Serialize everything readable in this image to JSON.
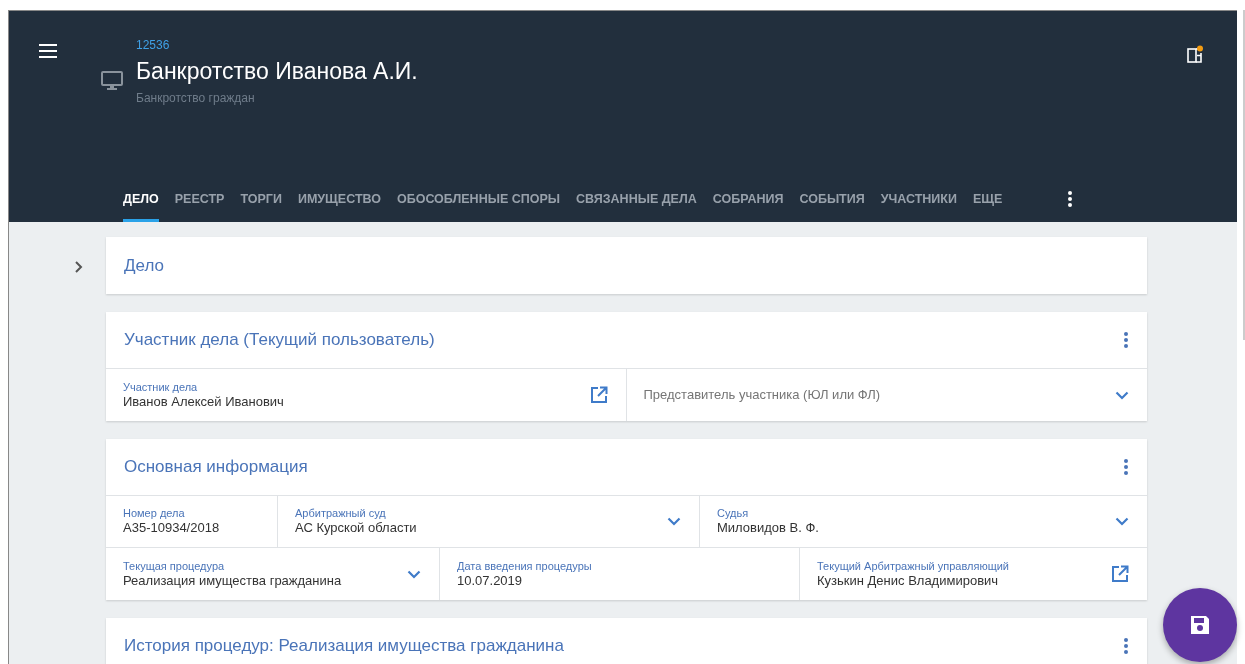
{
  "header": {
    "case_id": "12536",
    "title": "Банкротство Иванова А.И.",
    "subtitle": "Банкротство граждан"
  },
  "tabs": [
    {
      "label": "ДЕЛО",
      "selected": true
    },
    {
      "label": "РЕЕСТР",
      "selected": false
    },
    {
      "label": "ТОРГИ",
      "selected": false
    },
    {
      "label": "ИМУЩЕСТВО",
      "selected": false
    },
    {
      "label": "ОБОСОБЛЕННЫЕ СПОРЫ",
      "selected": false
    },
    {
      "label": "СВЯЗАННЫЕ ДЕЛА",
      "selected": false
    },
    {
      "label": "СОБРАНИЯ",
      "selected": false
    },
    {
      "label": "СОБЫТИЯ",
      "selected": false
    },
    {
      "label": "УЧАСТНИКИ",
      "selected": false
    },
    {
      "label": "ЕЩЕ",
      "selected": false
    }
  ],
  "sections": [
    {
      "title": "Дело",
      "collapsed": true
    },
    {
      "title": "Участник дела (Текущий пользователь)",
      "collapsed": false,
      "rows": [
        [
          {
            "label": "Участник дела",
            "value": "Иванов Алексей Иванович",
            "kind": "link"
          },
          {
            "placeholder": "Представитель участника (ЮЛ или ФЛ)",
            "kind": "dropdown"
          }
        ]
      ]
    },
    {
      "title": "Основная информация",
      "collapsed": false,
      "rows": [
        [
          {
            "label": "Номер дела",
            "value": "А35-10934/2018",
            "kind": "text"
          },
          {
            "label": "Арбитражный суд",
            "value": "АС Курской области",
            "kind": "dropdown"
          },
          {
            "label": "Судья",
            "value": "Миловидов В. Ф.",
            "kind": "dropdown"
          }
        ],
        [
          {
            "label": "Текущая процедура",
            "value": "Реализация имущества гражданина",
            "kind": "dropdown"
          },
          {
            "label": "Дата введения процедуры",
            "value": "10.07.2019",
            "kind": "text"
          },
          {
            "label": "Текущий Арбитражный управляющий",
            "value": "Кузькин Денис Владимирович",
            "kind": "link"
          }
        ]
      ]
    },
    {
      "title": "История процедур: Реализация имущества гражданина",
      "collapsed": false
    }
  ]
}
